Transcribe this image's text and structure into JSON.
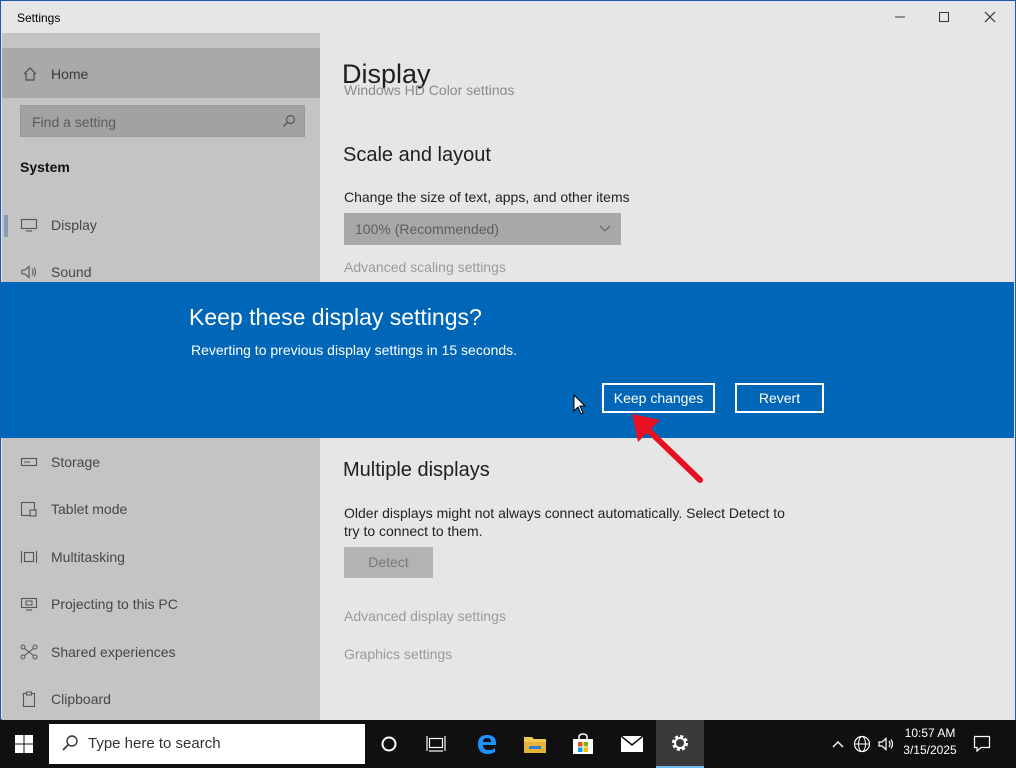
{
  "window": {
    "title": "Settings",
    "controls": {
      "minimize": "—",
      "maximize": "☐",
      "close": "✕"
    }
  },
  "sidebar": {
    "home_label": "Home",
    "search_placeholder": "Find a setting",
    "section_heading": "System",
    "items": [
      {
        "label": "Display",
        "icon": "monitor-icon"
      },
      {
        "label": "Sound",
        "icon": "speaker-icon"
      },
      {
        "label": "Storage",
        "icon": "storage-icon"
      },
      {
        "label": "Tablet mode",
        "icon": "tablet-icon"
      },
      {
        "label": "Multitasking",
        "icon": "multitask-icon"
      },
      {
        "label": "Projecting to this PC",
        "icon": "project-icon"
      },
      {
        "label": "Shared experiences",
        "icon": "share-icon"
      },
      {
        "label": "Clipboard",
        "icon": "clipboard-icon"
      }
    ]
  },
  "main": {
    "page_title": "Display",
    "clipped_link": "Windows HD Color settings",
    "scale_heading": "Scale and layout",
    "scale_desc": "Change the size of text, apps, and other items",
    "scale_value": "100% (Recommended)",
    "advanced_scaling": "Advanced scaling settings",
    "multiple_heading": "Multiple displays",
    "multiple_desc_1": "Older displays might not always connect automatically. Select Detect to",
    "multiple_desc_2": "try to connect to them.",
    "detect_label": "Detect",
    "advanced_display": "Advanced display settings",
    "graphics": "Graphics settings"
  },
  "dialog": {
    "title": "Keep these display settings?",
    "message": "Reverting to previous display settings in 15 seconds.",
    "keep_label": "Keep changes",
    "revert_label": "Revert"
  },
  "taskbar": {
    "search_placeholder": "Type here to search",
    "time": "10:57 AM",
    "date": "3/15/2025"
  },
  "colors": {
    "dialog_bg": "#0067b8",
    "annotation_arrow": "#e81123"
  }
}
